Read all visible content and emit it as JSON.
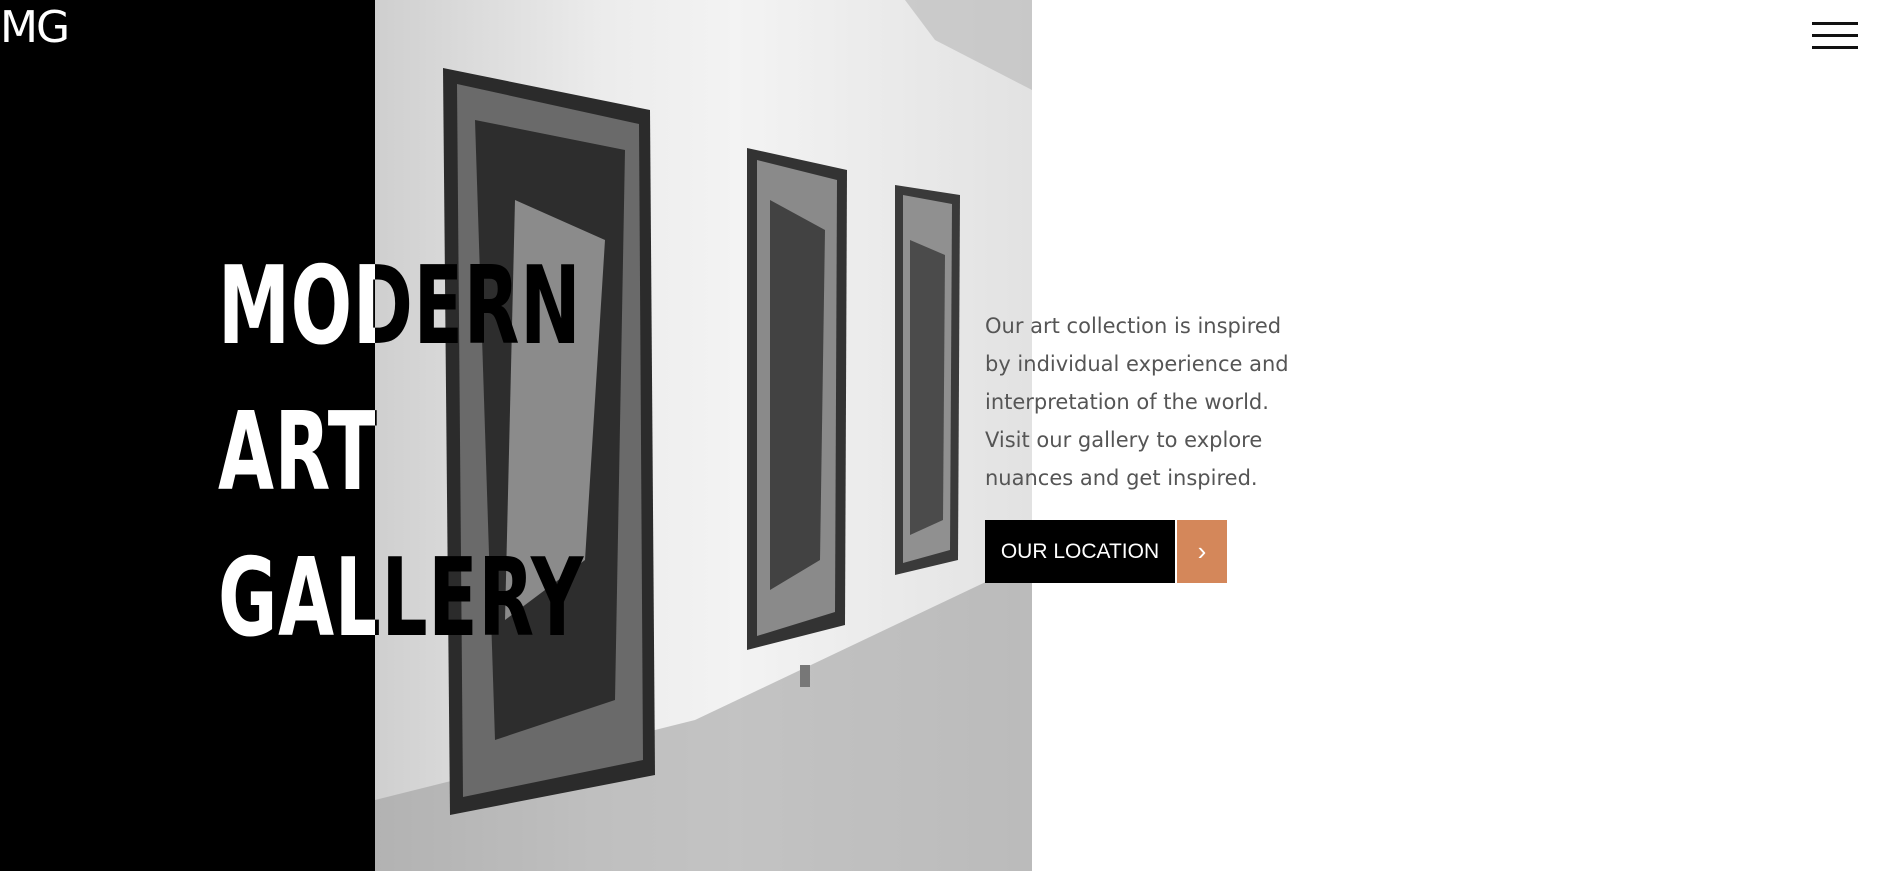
{
  "header": {
    "logo_text": "MG",
    "menu_icon": "hamburger-menu-icon"
  },
  "hero": {
    "title_line1": "MODERN ART",
    "title_line2": "GALLERY",
    "description": "Our art collection is inspired by individual experience and interpretation of the world. Visit our gallery to explore nuances and get inspired.",
    "image_alt": "art-gallery-photo"
  },
  "cta": {
    "label": "OUR LOCATION",
    "icon": "chevron-right-icon",
    "arrow_glyph": "›"
  },
  "colors": {
    "accent": "#d4875a",
    "black_panel": "#000000",
    "text_muted": "#555555"
  }
}
